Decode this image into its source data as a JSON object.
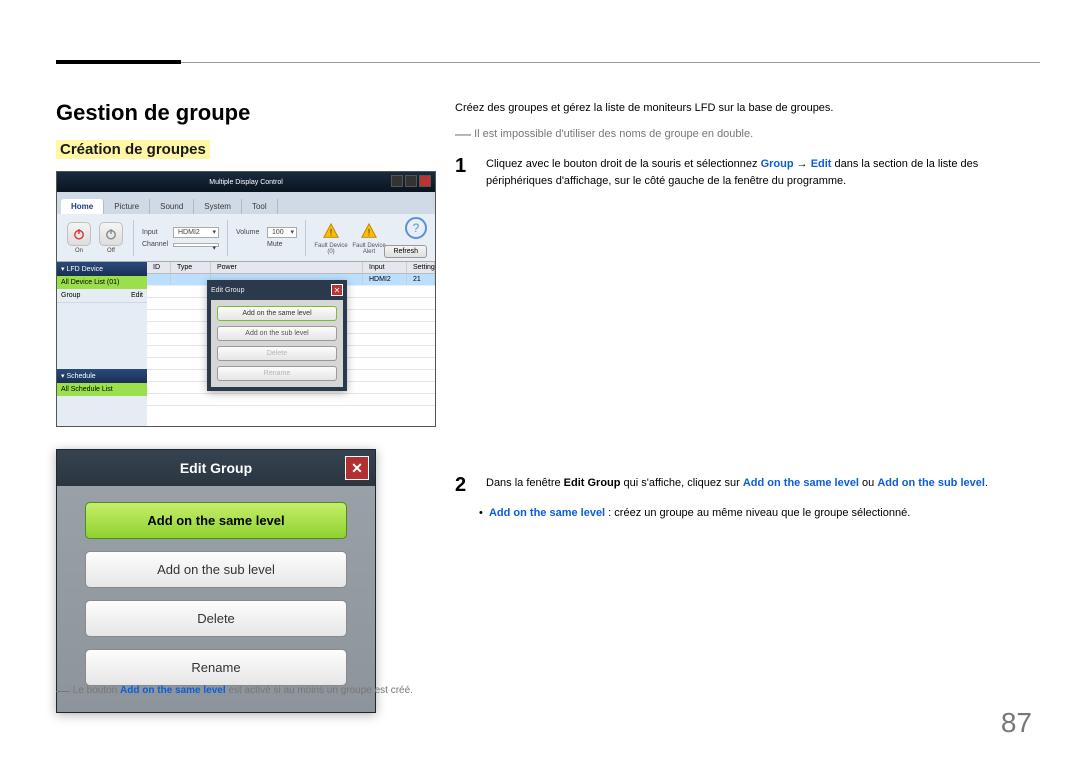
{
  "top": {
    "h1": "Gestion de groupe",
    "sub": "Création de groupes"
  },
  "right": {
    "intro": "Créez des groupes et gérez la liste de moniteurs LFD sur la base de groupes.",
    "note": "Il est impossible d'utiliser des noms de groupe en double.",
    "step1_a": "Cliquez avec le bouton droit de la souris et sélectionnez ",
    "step1_group": "Group",
    "step1_arrow": " → ",
    "step1_edit": "Edit",
    "step1_b": " dans la section de la liste des périphériques d'affichage, sur le côté gauche de la fenêtre du programme.",
    "step2_a": "Dans la fenêtre ",
    "step2_eg": "Edit Group",
    "step2_b": " qui s'affiche, cliquez sur ",
    "step2_asl": "Add on the same level",
    "step2_c": " ou ",
    "step2_asub": "Add on the sub level",
    "step2_d": ".",
    "bullet_a": "Add on the same level",
    "bullet_b": " : créez un groupe au même niveau que le groupe sélectionné."
  },
  "mdc": {
    "title": "Multiple Display Control",
    "tabs": [
      "Home",
      "Picture",
      "Sound",
      "System",
      "Tool"
    ],
    "pwr_on": "On",
    "pwr_off": "Off",
    "input_lbl": "Input",
    "input_val": "HDMI2",
    "channel_lbl": "Channel",
    "channel_val": "",
    "volume_lbl": "Volume",
    "volume_val": "100",
    "volume_mute": "Mute",
    "fault_lbl": "Fault Device (0)",
    "alert_lbl": "Fault Device Alert",
    "refresh": "Refresh",
    "side_lfd": "▾ LFD Device",
    "side_all": "All Device List (01)",
    "side_group_lbl": "Group",
    "side_group_edit": "Edit",
    "side_sched": "▾ Schedule",
    "side_sched_all": "All Schedule List",
    "grid_h_id": "ID",
    "grid_h_type": "Type",
    "grid_h_power": "Power",
    "grid_h_input": "Input",
    "grid_h_setting": "Setting",
    "grid_row_power": "HDMI2",
    "grid_row_setting": "21",
    "popup_title": "Edit Group",
    "popup_same": "Add on the same level",
    "popup_sub": "Add on the sub level",
    "popup_del": "Delete",
    "popup_ren": "Rename"
  },
  "egroup": {
    "title": "Edit Group",
    "same": "Add on the same level",
    "sub": "Add on the sub level",
    "del": "Delete",
    "ren": "Rename"
  },
  "footnote_a": "Le bouton ",
  "footnote_b": "Add on the same level",
  "footnote_c": " est activé si au moins un groupe est créé.",
  "page": "87"
}
